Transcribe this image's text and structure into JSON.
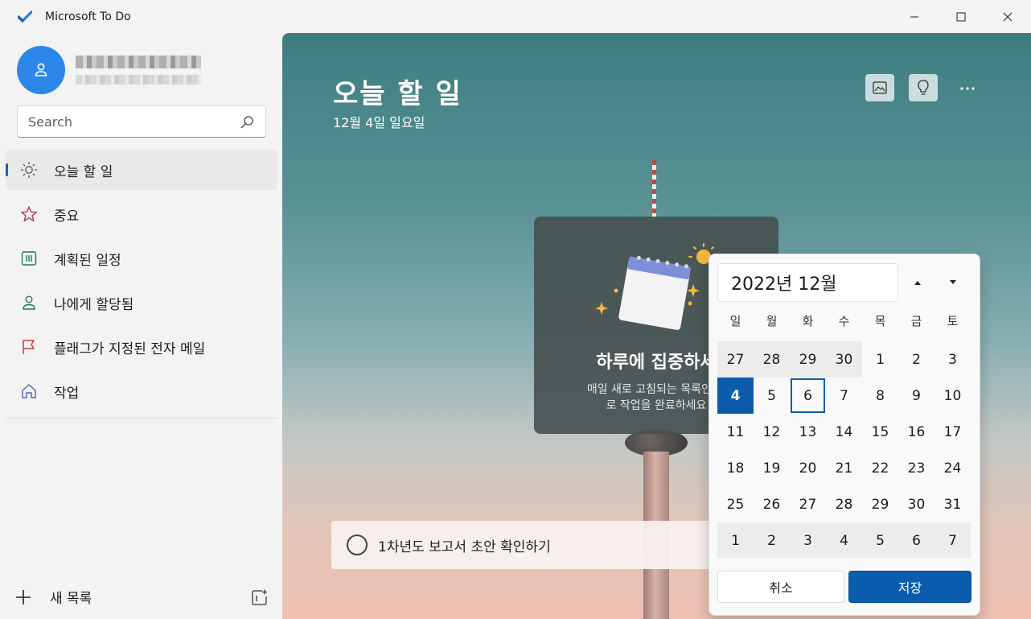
{
  "window": {
    "title": "Microsoft To Do"
  },
  "sidebar": {
    "search": {
      "placeholder": "Search"
    },
    "items": [
      {
        "label": "오늘 할 일",
        "icon": "sun-icon",
        "active": true
      },
      {
        "label": "중요",
        "icon": "star-icon"
      },
      {
        "label": "계획된 일정",
        "icon": "calendar-grid-icon"
      },
      {
        "label": "나에게 할당됨",
        "icon": "person-icon"
      },
      {
        "label": "플래그가 지정된 전자 메일",
        "icon": "flag-icon"
      },
      {
        "label": "작업",
        "icon": "home-icon"
      }
    ],
    "new_list_label": "새 목록"
  },
  "main": {
    "title": "오늘 할 일",
    "date": "12월 4일 일요일",
    "focus_card": {
      "title": "하루에 집중하세",
      "description": "매일 새로 고침되는 목록인 내\n로 작업을 완료하세요"
    },
    "task": {
      "title": "1차년도 보고서 초안 확인하기"
    }
  },
  "date_picker": {
    "month_label": "2022년 12월",
    "weekdays": [
      "일",
      "월",
      "화",
      "수",
      "목",
      "금",
      "토"
    ],
    "days": [
      {
        "d": "27",
        "o": true
      },
      {
        "d": "28",
        "o": true
      },
      {
        "d": "29",
        "o": true
      },
      {
        "d": "30",
        "o": true
      },
      {
        "d": "1"
      },
      {
        "d": "2"
      },
      {
        "d": "3"
      },
      {
        "d": "4",
        "sel": true
      },
      {
        "d": "5"
      },
      {
        "d": "6",
        "today": true
      },
      {
        "d": "7"
      },
      {
        "d": "8"
      },
      {
        "d": "9"
      },
      {
        "d": "10"
      },
      {
        "d": "11"
      },
      {
        "d": "12"
      },
      {
        "d": "13"
      },
      {
        "d": "14"
      },
      {
        "d": "15"
      },
      {
        "d": "16"
      },
      {
        "d": "17"
      },
      {
        "d": "18"
      },
      {
        "d": "19"
      },
      {
        "d": "20"
      },
      {
        "d": "21"
      },
      {
        "d": "22"
      },
      {
        "d": "23"
      },
      {
        "d": "24"
      },
      {
        "d": "25"
      },
      {
        "d": "26"
      },
      {
        "d": "27"
      },
      {
        "d": "28"
      },
      {
        "d": "29"
      },
      {
        "d": "30"
      },
      {
        "d": "31"
      },
      {
        "d": "1",
        "o": true
      },
      {
        "d": "2",
        "o": true
      },
      {
        "d": "3",
        "o": true
      },
      {
        "d": "4",
        "o": true
      },
      {
        "d": "5",
        "o": true
      },
      {
        "d": "6",
        "o": true
      },
      {
        "d": "7",
        "o": true
      }
    ],
    "cancel_label": "취소",
    "save_label": "저장"
  },
  "colors": {
    "accent": "#0b5cad",
    "avatar": "#2d87e8"
  }
}
